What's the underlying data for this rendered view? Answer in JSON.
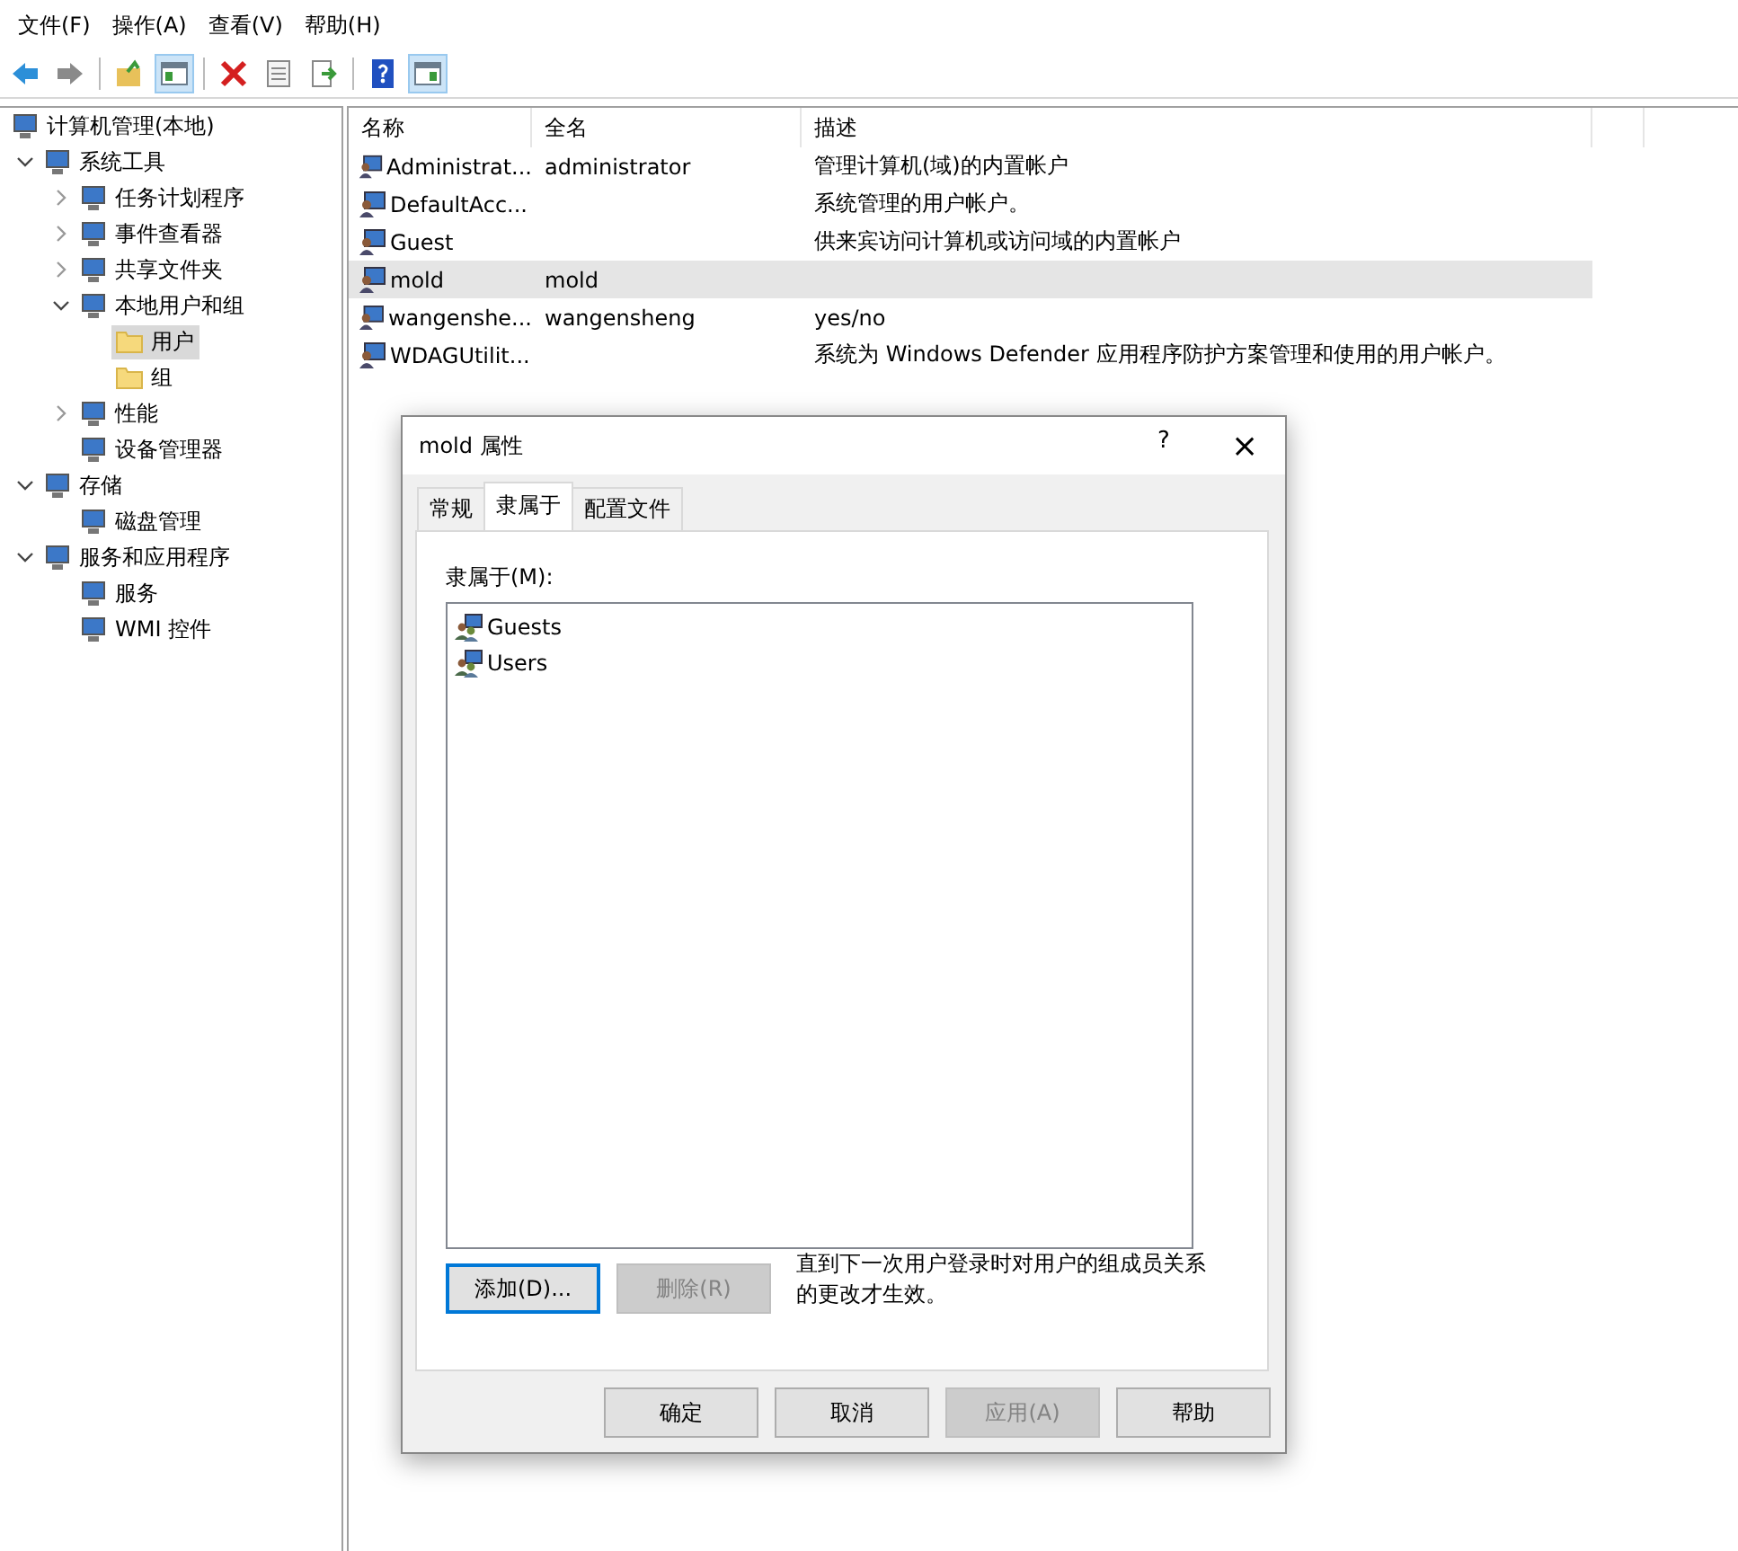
{
  "menu": [
    "文件(F)",
    "操作(A)",
    "查看(V)",
    "帮助(H)"
  ],
  "toolbar": [
    {
      "pressed": false
    },
    {
      "pressed": false
    },
    {
      "pressed": false
    },
    {
      "pressed": true
    },
    {
      "pressed": false
    },
    {
      "pressed": false
    },
    {
      "pressed": false
    },
    {
      "pressed": false
    },
    {
      "pressed": true
    }
  ],
  "tree": [
    {
      "label": "计算机管理(本地)",
      "selected": false,
      "children": [
        {
          "label": "系统工具",
          "selected": false,
          "expanded": true,
          "children": [
            {
              "label": "任务计划程序",
              "selected": false,
              "expanded": false
            },
            {
              "label": "事件查看器",
              "selected": false,
              "expanded": false
            },
            {
              "label": "共享文件夹",
              "selected": false,
              "expanded": false
            },
            {
              "label": "本地用户和组",
              "selected": false,
              "expanded": true,
              "children": [
                {
                  "label": "用户",
                  "selected": true,
                  "kind": "folder"
                },
                {
                  "label": "组",
                  "selected": false,
                  "kind": "folder"
                }
              ]
            },
            {
              "label": "性能",
              "selected": false,
              "expanded": false
            },
            {
              "label": "设备管理器",
              "selected": false
            }
          ]
        },
        {
          "label": "存储",
          "selected": false,
          "expanded": true,
          "children": [
            {
              "label": "磁盘管理",
              "selected": false
            }
          ]
        },
        {
          "label": "服务和应用程序",
          "selected": false,
          "expanded": true,
          "children": [
            {
              "label": "服务",
              "selected": false
            },
            {
              "label": "WMI 控件",
              "selected": false
            }
          ]
        }
      ]
    }
  ],
  "table": {
    "columns": [
      "名称",
      "全名",
      "描述"
    ],
    "rows": [
      {
        "name": "Administrat...",
        "full_name": "administrator",
        "description": "管理计算机(域)的内置帐户",
        "selected": false
      },
      {
        "name": "DefaultAcc...",
        "full_name": "",
        "description": "系统管理的用户帐户。",
        "selected": false
      },
      {
        "name": "Guest",
        "full_name": "",
        "description": "供来宾访问计算机或访问域的内置帐户",
        "selected": false
      },
      {
        "name": "mold",
        "full_name": "mold",
        "description": "",
        "selected": true
      },
      {
        "name": "wangenshe...",
        "full_name": "wangensheng",
        "description": "yes/no",
        "selected": false
      },
      {
        "name": "WDAGUtilit...",
        "full_name": "",
        "description": "系统为 Windows Defender 应用程序防护方案管理和使用的用户帐户。",
        "selected": false
      }
    ]
  },
  "dialog": {
    "title": "mold 属性",
    "help": "?",
    "close": "×",
    "tabs": [
      {
        "label": "常规",
        "selected": false
      },
      {
        "label": "隶属于",
        "selected": true
      },
      {
        "label": "配置文件",
        "selected": false
      }
    ],
    "member_label": "隶属于(M):",
    "groups": [
      "Guests",
      "Users"
    ],
    "add_button": {
      "label": "添加(D)...",
      "disabled": false
    },
    "remove_button": {
      "label": "删除(R)",
      "disabled": true
    },
    "note": "直到下一次用户登录时对用户的组成员关系的更改才生效。",
    "buttons": [
      {
        "label": "确定",
        "disabled": false
      },
      {
        "label": "取消",
        "disabled": false
      },
      {
        "label": "应用(A)",
        "disabled": true
      },
      {
        "label": "帮助",
        "disabled": false
      }
    ]
  }
}
